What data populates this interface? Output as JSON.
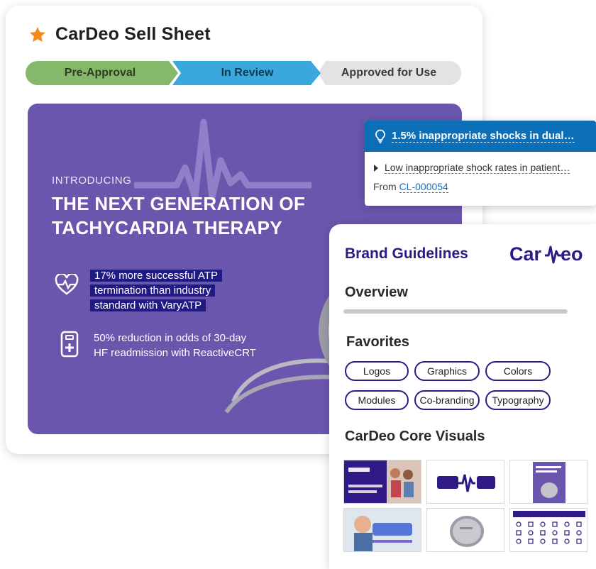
{
  "sell_sheet": {
    "title": "CarDeo Sell Sheet",
    "stages": [
      "Pre-Approval",
      "In Review",
      "Approved for Use"
    ],
    "stage_colors": [
      "#86b86b",
      "#3aa8dd",
      "#e3e3e3"
    ],
    "banner": {
      "intro": "INTRODUCING",
      "headline_line1": "THE NEXT GENERATION OF",
      "headline_line2": "TACHYCARDIA THERAPY",
      "benefit_1": "17% more successful ATP termination than industry standard with VaryATP",
      "benefit_2": "50% reduction in odds of 30-day HF readmission with ReactiveCRT",
      "background_color": "#6a57ad"
    }
  },
  "claim_popup": {
    "title": "1.5% inappropriate shocks in dual…",
    "body": "Low inappropriate shock rates in patient…",
    "from_label": "From",
    "claim_id": "CL-000054",
    "header_color": "#0d6fb8"
  },
  "brand_guidelines": {
    "title": "Brand Guidelines",
    "overview": "Overview",
    "favorites_heading": "Favorites",
    "favorites": [
      "Logos",
      "Graphics",
      "Colors",
      "Modules",
      "Co-branding",
      "Typography"
    ],
    "core_visuals_heading": "CarDeo Core Visuals",
    "brand_color": "#2f1a86"
  }
}
